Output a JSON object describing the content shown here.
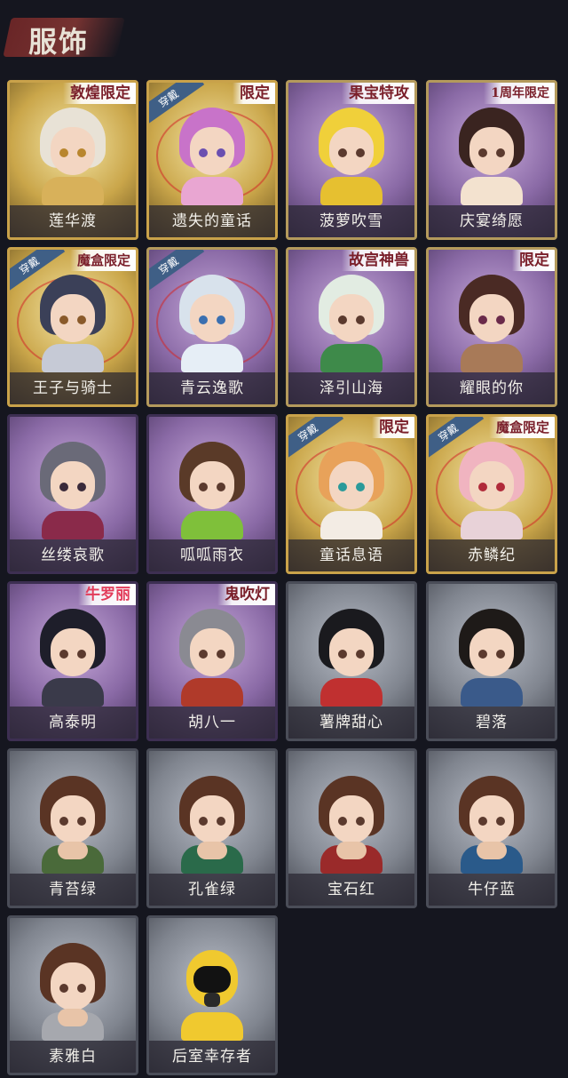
{
  "header": {
    "title": "服饰"
  },
  "tags": {
    "wearing": "穿戴",
    "dunhuang": "敦煌限定",
    "limited": "限定",
    "fruit": "果宝特攻",
    "anniversary": "1周年限定",
    "blindbox": "魔盒限定",
    "palace": "故宫神兽",
    "mahjong": "牛罗丽",
    "ghost": "鬼吹灯"
  },
  "costumes": [
    {
      "name": "莲华渡"
    },
    {
      "name": "遗失的童话"
    },
    {
      "name": "菠萝吹雪"
    },
    {
      "name": "庆宴绮愿"
    },
    {
      "name": "王子与骑士"
    },
    {
      "name": "青云逸歌"
    },
    {
      "name": "泽引山海"
    },
    {
      "name": "耀眼的你"
    },
    {
      "name": "丝缕哀歌"
    },
    {
      "name": "呱呱雨衣"
    },
    {
      "name": "童话息语"
    },
    {
      "name": "赤鳞纪"
    },
    {
      "name": "高泰明"
    },
    {
      "name": "胡八一"
    },
    {
      "name": "薯牌甜心"
    },
    {
      "name": "碧落"
    },
    {
      "name": "青苔绿"
    },
    {
      "name": "孔雀绿"
    },
    {
      "name": "宝石红"
    },
    {
      "name": "牛仔蓝"
    },
    {
      "name": "素雅白"
    },
    {
      "name": "后室幸存者"
    }
  ],
  "colors": {
    "gold_frame": "#c9a24a",
    "purple_bg": "#8a6aa6",
    "grey_bg": "#80858f",
    "page_bg": "#15161f"
  }
}
